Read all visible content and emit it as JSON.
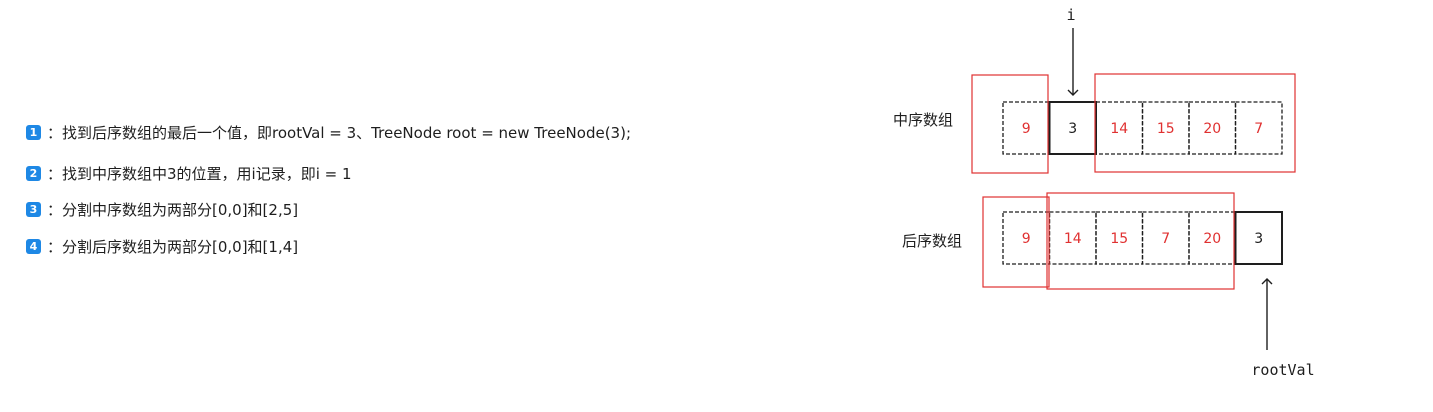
{
  "steps": [
    {
      "num": "1",
      "text": "：找到后序数组的最后一个值，即rootVal = 3、TreeNode root = new TreeNode(3);"
    },
    {
      "num": "2",
      "text": "：找到中序数组中3的位置，用i记录，即i = 1"
    },
    {
      "num": "3",
      "text": "：分割中序数组为两部分[0,0]和[2,5]"
    },
    {
      "num": "4",
      "text": "：分割后序数组为两部分[0,0]和[1,4]"
    }
  ],
  "inorder": {
    "label": "中序数组",
    "values": [
      "9",
      "3",
      "14",
      "15",
      "20",
      "7"
    ],
    "highlighted_index": 1
  },
  "postorder": {
    "label": "后序数组",
    "values": [
      "9",
      "14",
      "15",
      "7",
      "20",
      "3"
    ],
    "highlighted_index": 5
  },
  "pointers": {
    "i_label": "i",
    "root_label": "rootVal"
  },
  "colors": {
    "accent_red": "#e03131",
    "badge_blue": "#1e88e5",
    "stroke": "#1e1e1e"
  }
}
